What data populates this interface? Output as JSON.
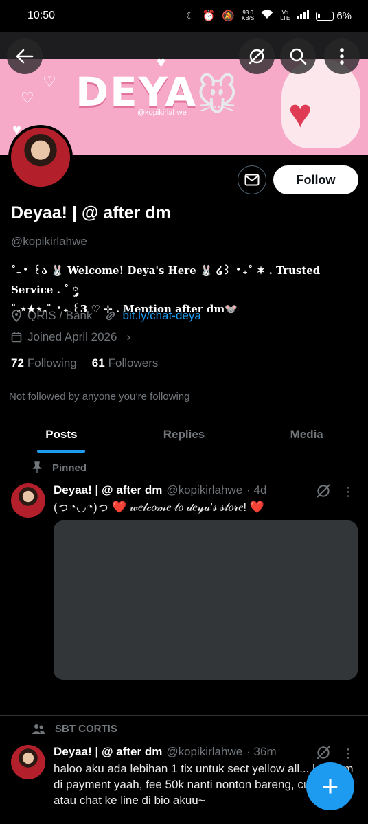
{
  "status_bar": {
    "time": "10:50",
    "speed_value": "93.0",
    "speed_unit": "KB/S",
    "network_top": "Vo",
    "network_bottom": "LTE",
    "battery": "6%"
  },
  "banner": {
    "title": "DEYA",
    "handle": "@kopikirlahwe",
    "bg_color": "#f7a9c8"
  },
  "top_actions": {
    "back_icon": "back-arrow-icon",
    "grok_icon": "grok-icon",
    "search_icon": "search-icon",
    "more_icon": "more-vertical-icon"
  },
  "profile": {
    "display_name": "Deyaa! | @ after dm",
    "username": "@kopikirlahwe",
    "bio_line1": "˚₊‧ ꒰ა 🐰 Welcome! Deya's Here 🐰 ໒꒱ ‧₊˚ ✶ . Trusted Service . ˚ ༘",
    "bio_line2": "˚｡⋆★⋆｡˚ ‧₊ ꒰3 ♡ ⊹ . Mention after dm🐭",
    "location": "QRIS / Bank",
    "link": "bit.ly/chat-deya",
    "joined": "Joined April 2026",
    "following_count": "72",
    "following_label": "Following",
    "followers_count": "61",
    "followers_label": "Followers",
    "not_followed_text": "Not followed by anyone you’re following",
    "follow_label": "Follow"
  },
  "tabs": [
    {
      "label": "Posts",
      "active": true
    },
    {
      "label": "Replies",
      "active": false
    },
    {
      "label": "Media",
      "active": false
    }
  ],
  "posts": [
    {
      "context": "Pinned",
      "name": "Deyaa! | @ after dm",
      "handle": "@kopikirlahwe",
      "time": "· 4d",
      "text": "(っ◔◡◔)っ ❤️ 𝓌𝑒𝓁𝒸𝑜𝓂𝑒 𝓉𝑜 𝒹𝑒𝓎𝒶'𝓈 𝓈𝓉𝑜𝓇𝑒! ❤️"
    },
    {
      "context": "SBT CORTIS",
      "name": "Deyaa! | @ after dm",
      "handle": "@kopikirlahwe",
      "time": "· 36m",
      "text": "haloo aku ada lebihan 1 tix untuk sect yellow all... k belum di payment yaah, fee 50k nanti nonton bareng, cus dm atau chat ke line di bio akuu~"
    }
  ],
  "fab": {
    "label": "+"
  },
  "colors": {
    "accent": "#1d9bf0",
    "background": "#000000",
    "muted": "#71767b"
  }
}
